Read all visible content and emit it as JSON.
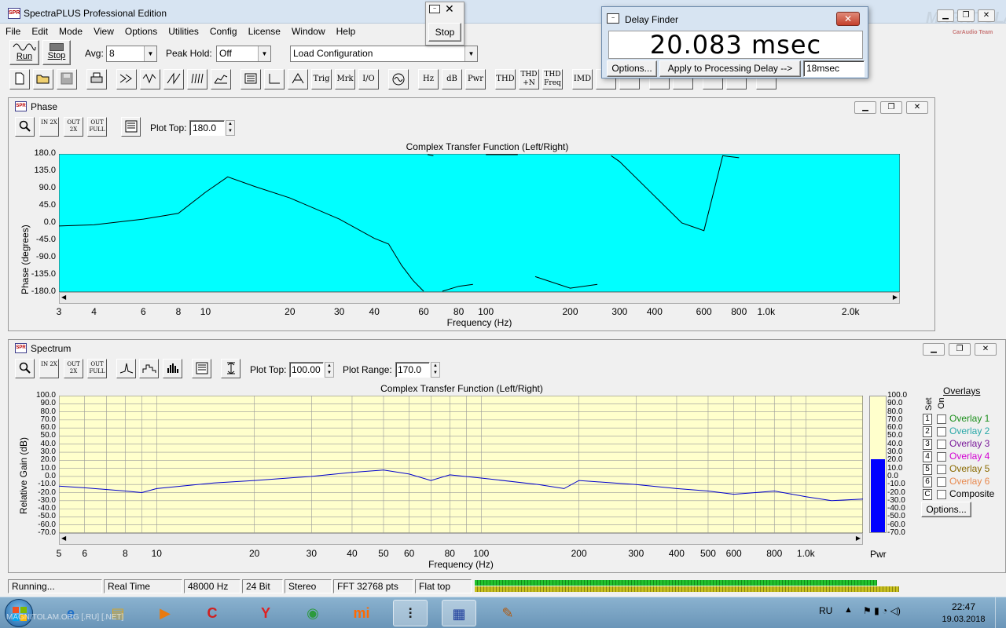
{
  "app": {
    "title": "SpectraPLUS Professional Edition",
    "icon_text": "SPR"
  },
  "menu": [
    "File",
    "Edit",
    "Mode",
    "View",
    "Options",
    "Utilities",
    "Config",
    "License",
    "Window",
    "Help"
  ],
  "toolbar": {
    "run_label": "Run",
    "stop_label": "Stop",
    "avg_label": "Avg:",
    "avg_value": "8",
    "peak_hold_label": "Peak Hold:",
    "peak_hold_value": "Off",
    "load_config": "Load Configuration",
    "text_buttons": [
      "Trig",
      "Mrk",
      "I/O",
      "Hz",
      "dB",
      "Pwr",
      "THD",
      "THD +N",
      "THD Freq",
      "IMD"
    ]
  },
  "stop_popup": {
    "stop_label": "Stop"
  },
  "delay_finder": {
    "title": "Delay Finder",
    "value": "20.083 msec",
    "options_label": "Options...",
    "apply_label": "Apply to Processing Delay -->",
    "delay_field": "18msec"
  },
  "watermark": {
    "main": "MAGNITOLA",
    "sub": "CarAudio Team"
  },
  "phase": {
    "title": "Phase",
    "plot_top_label": "Plot Top:",
    "plot_top_value": "180.0",
    "zoom_labels": [
      "IN 2X",
      "OUT 2X",
      "OUT FULL"
    ],
    "chart_title": "Complex Transfer Function (Left/Right)",
    "ylabel": "Phase (degrees)",
    "xlabel": "Frequency (Hz)",
    "yticks": [
      "180.0",
      "135.0",
      "90.0",
      "45.0",
      "0.0",
      "-45.0",
      "-90.0",
      "-135.0",
      "-180.0"
    ],
    "xticks": [
      "3",
      "4",
      "6",
      "8",
      "10",
      "20",
      "30",
      "40",
      "60",
      "80",
      "100",
      "200",
      "300",
      "400",
      "600",
      "800",
      "1.0k",
      "2.0k"
    ]
  },
  "spectrum": {
    "title": "Spectrum",
    "plot_top_label": "Plot Top:",
    "plot_top_value": "100.00",
    "plot_range_label": "Plot Range:",
    "plot_range_value": "170.0",
    "zoom_labels": [
      "IN 2X",
      "OUT 2X",
      "OUT FULL"
    ],
    "chart_title": "Complex Transfer Function (Left/Right)",
    "ylabel": "Relative Gain (dB)",
    "xlabel": "Frequency (Hz)",
    "yticks": [
      "100.0",
      "90.0",
      "80.0",
      "70.0",
      "60.0",
      "50.0",
      "40.0",
      "30.0",
      "20.0",
      "10.0",
      "0.0",
      "-10.0",
      "-20.0",
      "-30.0",
      "-40.0",
      "-50.0",
      "-60.0",
      "-70.0"
    ],
    "xticks": [
      "5",
      "6",
      "8",
      "10",
      "20",
      "30",
      "40",
      "50",
      "60",
      "80",
      "100",
      "200",
      "300",
      "400",
      "500",
      "600",
      "800",
      "1.0k"
    ],
    "pwr_label": "Pwr",
    "pwr_ticks": [
      "100.0",
      "90.0",
      "80.0",
      "70.0",
      "60.0",
      "50.0",
      "40.0",
      "30.0",
      "20.0",
      "10.0",
      "0.0",
      "-10.0",
      "-20.0",
      "-30.0",
      "-40.0",
      "-50.0",
      "-60.0",
      "-70.0"
    ],
    "pwr_level_db": 20,
    "overlays_title": "Overlays",
    "set_label": "Set",
    "on_label": "On",
    "overlays": [
      {
        "num": "1",
        "label": "Overlay 1",
        "color": "#1b8f1b"
      },
      {
        "num": "2",
        "label": "Overlay 2",
        "color": "#2aa8a8"
      },
      {
        "num": "3",
        "label": "Overlay 3",
        "color": "#7a1a9a"
      },
      {
        "num": "4",
        "label": "Overlay 4",
        "color": "#d200d2"
      },
      {
        "num": "5",
        "label": "Overlay 5",
        "color": "#8a6a00"
      },
      {
        "num": "6",
        "label": "Overlay 6",
        "color": "#e88a50"
      },
      {
        "num": "C",
        "label": "Composite",
        "color": "#000000"
      }
    ],
    "options_label": "Options..."
  },
  "status": {
    "cells": [
      "Running...",
      "Real Time",
      "48000 Hz",
      "24 Bit",
      "Stereo",
      "FFT 32768 pts",
      "Flat top"
    ]
  },
  "taskbar": {
    "watermark": "MAGNITOLAM.ORG [.RU] [.NET]",
    "lang": "RU",
    "time": "22:47",
    "date": "19.03.2018"
  },
  "colors": {
    "phase_bg": "#00ffff",
    "spectrum_bg": "#ffffcc",
    "trace": "#000000",
    "spectrum_trace": "#0000cc",
    "pwr_bar": "#0000ff",
    "level_green": "#22c22e"
  },
  "chart_data": [
    {
      "type": "line",
      "title": "Complex Transfer Function (Left/Right)",
      "xlabel": "Frequency (Hz)",
      "ylabel": "Phase (degrees)",
      "xscale": "log",
      "xlim": [
        3,
        3000
      ],
      "ylim": [
        -180,
        180
      ],
      "grid": false,
      "x": [
        3,
        4,
        6,
        8,
        10,
        12,
        15,
        20,
        30,
        40,
        45,
        50,
        55,
        60,
        62,
        65,
        70,
        80,
        90,
        100,
        130,
        150,
        200,
        250,
        280,
        300,
        400,
        500,
        600,
        700,
        800,
        1000
      ],
      "y": [
        -8,
        -5,
        10,
        25,
        80,
        120,
        95,
        65,
        10,
        -40,
        -55,
        -110,
        -150,
        -178,
        178,
        175,
        -178,
        -165,
        -160,
        178,
        178,
        -140,
        -170,
        -160,
        175,
        160,
        70,
        0,
        -20,
        175,
        170,
        -170
      ]
    },
    {
      "type": "line",
      "title": "Complex Transfer Function (Left/Right)",
      "xlabel": "Frequency (Hz)",
      "ylabel": "Relative Gain (dB)",
      "xscale": "log",
      "xlim": [
        5,
        1500
      ],
      "ylim": [
        -70,
        100
      ],
      "grid": true,
      "x": [
        5,
        6,
        8,
        9,
        10,
        15,
        20,
        30,
        40,
        50,
        60,
        70,
        80,
        100,
        150,
        180,
        200,
        300,
        400,
        500,
        600,
        700,
        800,
        1000,
        1200,
        1500
      ],
      "y": [
        -12,
        -14,
        -18,
        -20,
        -15,
        -8,
        -5,
        0,
        5,
        8,
        3,
        -5,
        2,
        -2,
        -10,
        -15,
        -5,
        -10,
        -15,
        -18,
        -22,
        -20,
        -18,
        -25,
        -30,
        -28
      ]
    }
  ]
}
